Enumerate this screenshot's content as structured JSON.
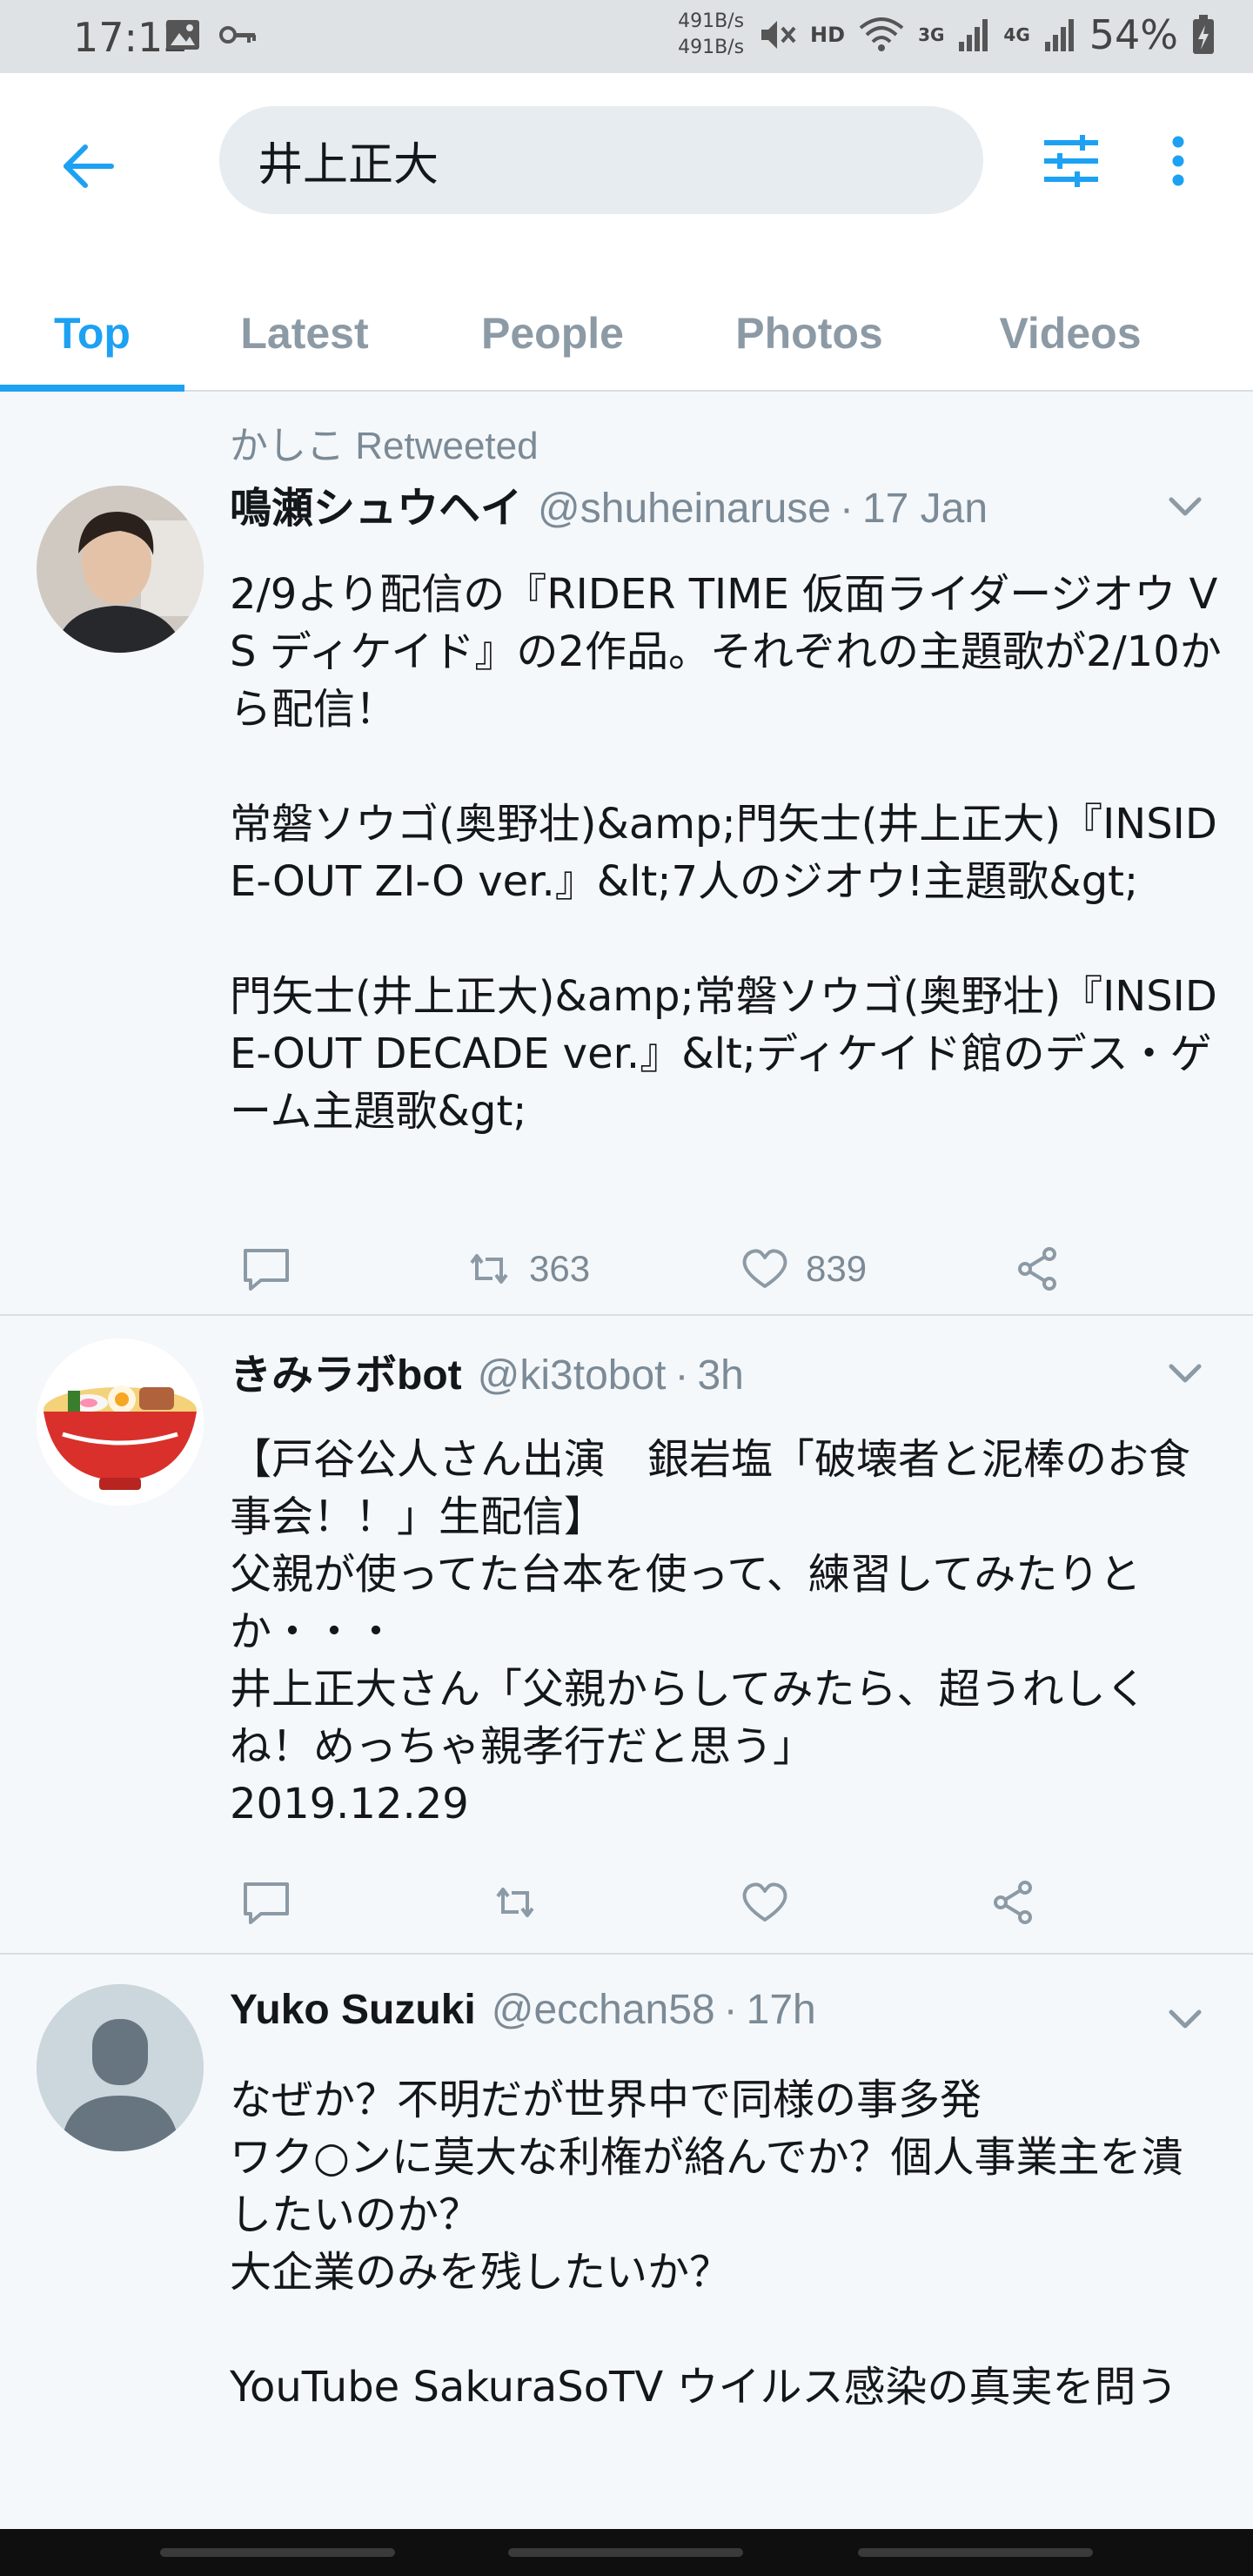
{
  "status_bar": {
    "time": "17:12",
    "net_speed_up": "491B/s",
    "net_speed_down": "491B/s",
    "hd": "HD",
    "signal_3g": "3G",
    "signal_4g": "4G",
    "battery": "54%"
  },
  "search": {
    "query": "井上正大"
  },
  "tabs": [
    {
      "label": "Top",
      "active": true
    },
    {
      "label": "Latest",
      "active": false
    },
    {
      "label": "People",
      "active": false
    },
    {
      "label": "Photos",
      "active": false
    },
    {
      "label": "Videos",
      "active": false
    }
  ],
  "tweets": [
    {
      "retweeted_by": "かしこ Retweeted",
      "name": "鳴瀬シュウヘイ",
      "handle": "@shuheinaruse",
      "sep": "·",
      "time": "17 Jan",
      "body": "2/9より配信の『RIDER TIME 仮面ライダージオウ VS ディケイド』の2作品。それぞれの主題歌が2/10から配信！\n\n常磐ソウゴ(奥野壮)&amp;門矢士(井上正大)『INSIDE-OUT ZI-O ver.』&lt;7人のジオウ!主題歌&gt;\n\n門矢士(井上正大)&amp;常磐ソウゴ(奥野壮)『INSIDE-OUT DECADE ver.』&lt;ディケイド館のデス・ゲーム主題歌&gt;",
      "retweets": "363",
      "likes": "839",
      "avatar_icon": "person-photo-icon"
    },
    {
      "name": "きみラボbot",
      "handle": "@ki3tobot",
      "sep": "·",
      "time": "3h",
      "body": "【戸谷公人さん出演　銀岩塩「破壊者と泥棒のお食事会！！」生配信】\n父親が使ってた台本を使って、練習してみたりとか・・・\n井上正大さん「父親からしてみたら、超うれしくね！めっちゃ親孝行だと思う」\n2019.12.29",
      "retweets": "",
      "likes": "",
      "avatar_icon": "ramen-bowl-icon"
    },
    {
      "name": "Yuko Suzuki",
      "handle": "@ecchan58",
      "sep": "·",
      "time": "17h",
      "body": "なぜか？不明だが世界中で同様の事多発\nワク○ンに莫大な利権が絡んでか？個人事業主を潰したいのか？\n大企業のみを残したいか？\n\nYouTube SakuraSoTV ウイルス感染の真実を問う",
      "avatar_icon": "default-avatar-icon"
    }
  ],
  "colors": {
    "accent": "#1da1f2",
    "muted": "#7b8a96",
    "background": "#f5f8fa"
  }
}
